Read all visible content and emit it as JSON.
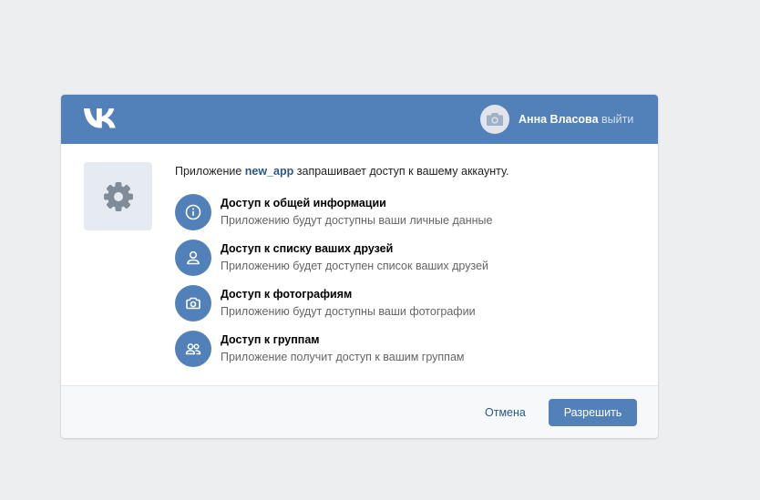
{
  "header": {
    "logo": "vk-logo",
    "user_name": "Анна Власова",
    "logout_label": "выйти"
  },
  "request": {
    "prefix": "Приложение ",
    "app_name": "new_app",
    "suffix": " запрашивает доступ к вашему аккаунту."
  },
  "permissions": [
    {
      "icon": "info-icon",
      "title": "Доступ к общей информации",
      "description": "Приложению будут доступны ваши личные данные"
    },
    {
      "icon": "user-icon",
      "title": "Доступ к списку ваших друзей",
      "description": "Приложению будет доступен список ваших друзей"
    },
    {
      "icon": "camera-icon",
      "title": "Доступ к фотографиям",
      "description": "Приложению будут доступны ваши фотографии"
    },
    {
      "icon": "users-icon",
      "title": "Доступ к группам",
      "description": "Приложение получит доступ к вашим группам"
    }
  ],
  "footer": {
    "cancel_label": "Отмена",
    "allow_label": "Разрешить"
  },
  "colors": {
    "brand": "#5181b8",
    "page_bg": "#edeef0",
    "link": "#2a5885"
  }
}
